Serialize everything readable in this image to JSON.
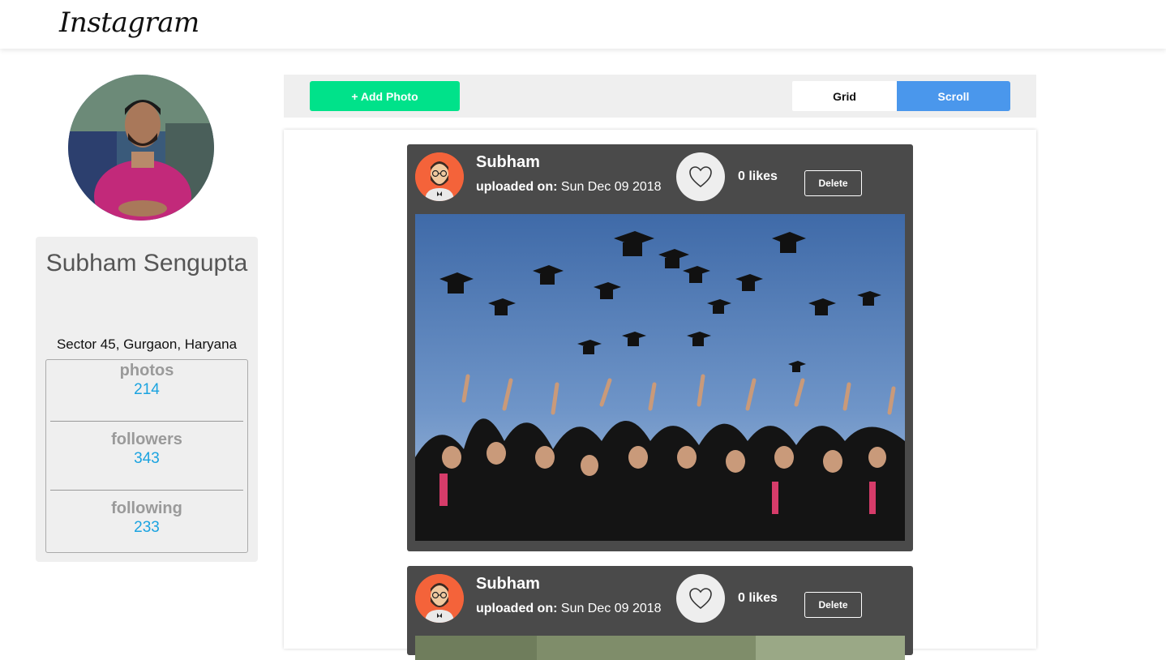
{
  "header": {
    "logo_text": "Instagram"
  },
  "profile": {
    "name": "Subham Sengupta",
    "location": "Sector 45, Gurgaon, Haryana",
    "stats": [
      {
        "label": "photos",
        "value": "214"
      },
      {
        "label": "followers",
        "value": "343"
      },
      {
        "label": "following",
        "value": "233"
      }
    ]
  },
  "toolbar": {
    "add_photo_label": "+ Add Photo",
    "view_modes": [
      {
        "label": "Grid",
        "active": false
      },
      {
        "label": "Scroll",
        "active": true
      }
    ]
  },
  "colors": {
    "accent_green": "#00e28a",
    "accent_blue": "#4a97ec",
    "stat_value_blue": "#1aa3e0",
    "post_bg": "#4a4a4a"
  },
  "posts": [
    {
      "user": "Subham",
      "uploaded_label": "uploaded on:",
      "date": "Sun Dec 09 2018",
      "likes": "0 likes",
      "delete_label": "Delete",
      "like_icon": "heart-icon"
    },
    {
      "user": "Subham",
      "uploaded_label": "uploaded on:",
      "date": "Sun Dec 09 2018",
      "likes": "0 likes",
      "delete_label": "Delete",
      "like_icon": "heart-icon"
    }
  ]
}
